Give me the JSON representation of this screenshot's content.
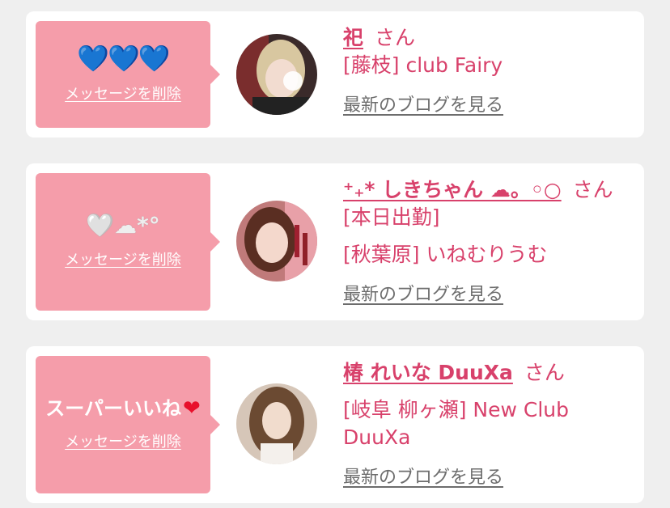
{
  "cards": [
    {
      "message": "💙💙💙",
      "delete_label": "メッセージを削除",
      "name": "祀",
      "san": "さん",
      "status": "",
      "shop": "[藤枝] club Fairy",
      "blog_label": "最新のブログを見る"
    },
    {
      "message": "🤍☁*°",
      "delete_label": "メッセージを削除",
      "name": "⁺₊* しきちゃん ☁。◦○",
      "san": "さん[本日出勤]",
      "shop": "[秋葉原] いねむりうむ",
      "blog_label": "最新のブログを見る"
    },
    {
      "message_text": "スーパーいいね",
      "message_emoji": "❤",
      "delete_label": "メッセージを削除",
      "name": "椿 れいな DuuXa",
      "san": "さん",
      "shop": "[岐阜 柳ヶ瀬] New Club DuuXa",
      "blog_label": "最新のブログを見る"
    }
  ],
  "colors": {
    "accent_pink": "#f59daa",
    "name_pink": "#d8416b",
    "link_gray": "#6d6d6d",
    "background": "#efefef"
  }
}
